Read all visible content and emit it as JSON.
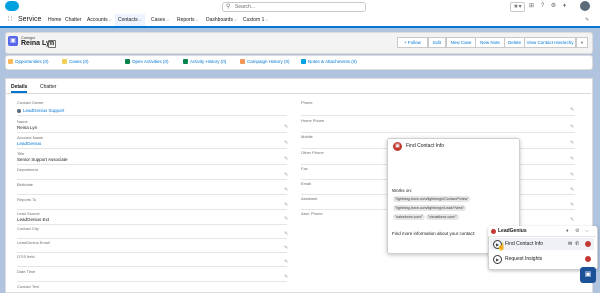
{
  "header": {
    "search_placeholder": "Search...",
    "icons": [
      "salesforce-logo",
      "search-icon",
      "star-icon",
      "add-icon",
      "help-icon",
      "setup-icon",
      "bell-icon",
      "avatar"
    ]
  },
  "nav": {
    "app_name": "Service",
    "items": [
      {
        "label": "Home",
        "chevron": false
      },
      {
        "label": "Chatter",
        "chevron": false
      },
      {
        "label": "Accounts",
        "chevron": true
      },
      {
        "label": "Contacts",
        "chevron": true
      },
      {
        "label": "Cases",
        "chevron": true
      },
      {
        "label": "Reports",
        "chevron": true
      },
      {
        "label": "Dashboards",
        "chevron": true
      },
      {
        "label": "Custom 1",
        "chevron": true
      }
    ]
  },
  "record": {
    "type": "Contact",
    "name": "Reina Lyn",
    "buttons": [
      "+ Follow",
      "Edit",
      "New Case",
      "New Note",
      "Delete",
      "View Contact Hierarchy"
    ]
  },
  "related": [
    {
      "label": "Opportunities (0)",
      "color": "#fcb95b"
    },
    {
      "label": "Cases (0)",
      "color": "#f2cf5b"
    },
    {
      "label": "Open Activities (0)",
      "color": "#04844b"
    },
    {
      "label": "Activity History (0)",
      "color": "#04844b"
    },
    {
      "label": "Campaign History (0)",
      "color": "#f49756"
    },
    {
      "label": "Notes & Attachments (0)",
      "color": "#00a1e0"
    }
  ],
  "tabs": [
    "Details",
    "Chatter"
  ],
  "fields_left": [
    {
      "label": "Contact Owner",
      "value": "LeadGenius Support",
      "link": true
    },
    {
      "label": "Name",
      "value": "Reina Lyn",
      "link": false
    },
    {
      "label": "Account Name",
      "value": "LeadGenius",
      "link": true
    },
    {
      "label": "Title",
      "value": "Senior Support Associate",
      "link": false
    },
    {
      "label": "Department",
      "value": "",
      "link": false
    },
    {
      "label": "Birthdate",
      "value": "",
      "link": false
    },
    {
      "label": "Reports To",
      "value": "",
      "link": false
    },
    {
      "label": "Lead Source",
      "value": "LeadGenius Ext",
      "link": false
    },
    {
      "label": "Contact City",
      "value": "",
      "link": false
    },
    {
      "label": "LeadGenius Email",
      "value": "",
      "link": false
    },
    {
      "label": "DTIS field",
      "value": "",
      "link": false
    },
    {
      "label": "Date Time",
      "value": "",
      "link": false
    },
    {
      "label": "Contact Text",
      "value": "",
      "link": false
    }
  ],
  "fields_right": [
    "Phone",
    "Home Phone",
    "Mobile",
    "Other Phone",
    "Fax",
    "Email",
    "Assistant",
    "Asst. Phone"
  ],
  "popup": {
    "title": "Find Contact Info",
    "works_on": "Works on:",
    "pills": [
      "\"lightning-force.com/lightning/r/Contact/*/view\"",
      "\"lightning-force.com/lightning/r/Lead/*/view\"",
      "\"salesforce.com/\"",
      "\"visualforce.com/\""
    ],
    "more": "Find more information about your contact:"
  },
  "widget": {
    "title": "LeadGenius",
    "row1": "Find Contact Info",
    "row2": "Request Insights"
  }
}
